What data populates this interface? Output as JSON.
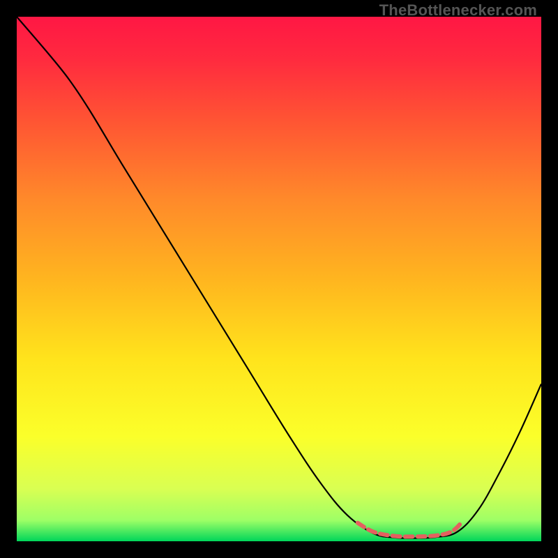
{
  "watermark": "TheBottlenecker.com",
  "chart_data": {
    "type": "line",
    "title": "",
    "xlabel": "",
    "ylabel": "",
    "xlim": [
      0,
      100
    ],
    "ylim": [
      0,
      100
    ],
    "grid": false,
    "background_gradient": {
      "stops": [
        {
          "offset": 0.0,
          "color": "#ff1744"
        },
        {
          "offset": 0.08,
          "color": "#ff2a3f"
        },
        {
          "offset": 0.2,
          "color": "#ff5533"
        },
        {
          "offset": 0.35,
          "color": "#ff8a2a"
        },
        {
          "offset": 0.5,
          "color": "#ffb51f"
        },
        {
          "offset": 0.65,
          "color": "#ffe31c"
        },
        {
          "offset": 0.8,
          "color": "#fbff2a"
        },
        {
          "offset": 0.9,
          "color": "#d9ff52"
        },
        {
          "offset": 0.96,
          "color": "#9eff66"
        },
        {
          "offset": 1.0,
          "color": "#00d65a"
        }
      ]
    },
    "series": [
      {
        "name": "bottleneck-curve",
        "color": "#000000",
        "width": 2.2,
        "points": [
          {
            "x": 0,
            "y": 100
          },
          {
            "x": 6,
            "y": 93
          },
          {
            "x": 10,
            "y": 88
          },
          {
            "x": 14,
            "y": 82
          },
          {
            "x": 20,
            "y": 72
          },
          {
            "x": 28,
            "y": 59
          },
          {
            "x": 36,
            "y": 46
          },
          {
            "x": 44,
            "y": 33
          },
          {
            "x": 52,
            "y": 20
          },
          {
            "x": 58,
            "y": 11
          },
          {
            "x": 63,
            "y": 5
          },
          {
            "x": 68,
            "y": 1.5
          },
          {
            "x": 72,
            "y": 0.7
          },
          {
            "x": 76,
            "y": 0.6
          },
          {
            "x": 80,
            "y": 0.8
          },
          {
            "x": 84,
            "y": 1.8
          },
          {
            "x": 88,
            "y": 6
          },
          {
            "x": 92,
            "y": 13
          },
          {
            "x": 96,
            "y": 21
          },
          {
            "x": 100,
            "y": 30
          }
        ]
      },
      {
        "name": "optimal-band",
        "color": "#e4605f",
        "width": 6,
        "dash": "11 7",
        "points": [
          {
            "x": 65,
            "y": 3.5
          },
          {
            "x": 68,
            "y": 1.8
          },
          {
            "x": 72,
            "y": 1.0
          },
          {
            "x": 76,
            "y": 0.9
          },
          {
            "x": 80,
            "y": 1.1
          },
          {
            "x": 83,
            "y": 1.9
          },
          {
            "x": 85,
            "y": 3.8
          }
        ]
      }
    ]
  }
}
